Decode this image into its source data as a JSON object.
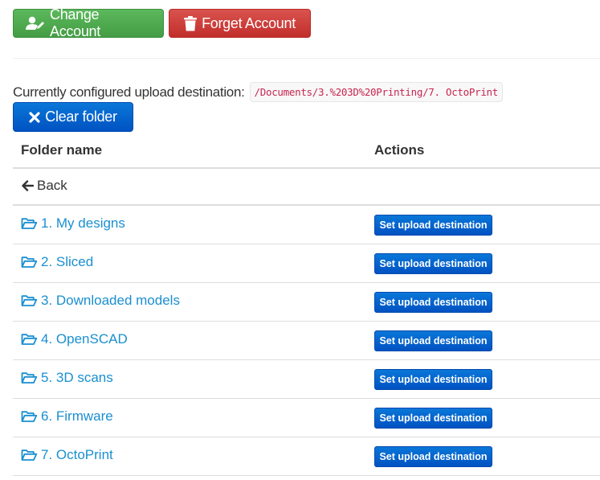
{
  "toolbar": {
    "change_account_label": "Change Account",
    "forget_account_label": "Forget Account",
    "change_account_icon": "user-edit-icon",
    "forget_account_icon": "trash-icon"
  },
  "destination": {
    "label": "Currently configured upload destination:",
    "path": "/Documents/3.%203D%20Printing/7. OctoPrint",
    "clear_label": "Clear folder",
    "clear_icon": "close-icon"
  },
  "table": {
    "headers": [
      "Folder name",
      "Actions"
    ],
    "back_label": "Back",
    "back_icon": "arrow-left-icon",
    "folder_icon": "folder-open-icon",
    "rows": [
      {
        "name": "1. My designs",
        "action": "Set upload destination"
      },
      {
        "name": "2. Sliced",
        "action": "Set upload destination"
      },
      {
        "name": "3. Downloaded models",
        "action": "Set upload destination"
      },
      {
        "name": "4. OpenSCAD",
        "action": "Set upload destination"
      },
      {
        "name": "5. 3D scans",
        "action": "Set upload destination"
      },
      {
        "name": "6. Firmware",
        "action": "Set upload destination"
      },
      {
        "name": "7. OctoPrint",
        "action": "Set upload destination"
      }
    ]
  },
  "colors": {
    "success": "#5cb85c",
    "danger": "#d9534f",
    "primary": "#0a6fd3",
    "link": "#1a8fd0",
    "code": "#c7254e"
  }
}
